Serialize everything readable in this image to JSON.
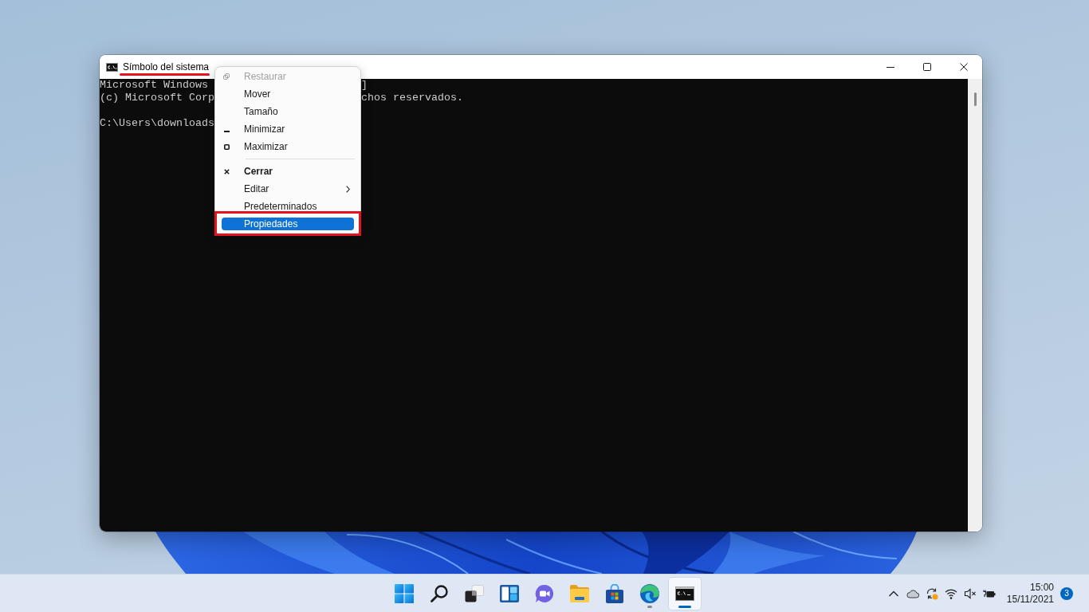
{
  "window": {
    "title": "Símbolo del sistema",
    "title_underlined": true,
    "terminal": {
      "banner": [
        {
          "start": "Microsoft Windows",
          "end": "]"
        },
        {
          "start": "(c) Microsoft Corp",
          "end": "chos reservados."
        }
      ],
      "prompt": "C:\\Users\\downloads"
    }
  },
  "context_menu": {
    "groups": [
      [
        {
          "label": "Restaurar",
          "kind": "restore",
          "disabled": true,
          "default": false,
          "selected": false,
          "highlighted": false
        },
        {
          "label": "Mover",
          "kind": "plain",
          "disabled": false,
          "default": false,
          "selected": false,
          "highlighted": false
        },
        {
          "label": "Tamaño",
          "kind": "plain",
          "disabled": false,
          "default": false,
          "selected": false,
          "highlighted": false
        },
        {
          "label": "Minimizar",
          "kind": "minimize",
          "disabled": false,
          "default": false,
          "selected": false,
          "highlighted": false
        },
        {
          "label": "Maximizar",
          "kind": "maximize",
          "disabled": false,
          "default": false,
          "selected": false,
          "highlighted": false
        }
      ],
      [
        {
          "label": "Cerrar",
          "kind": "close",
          "disabled": false,
          "default": true,
          "selected": false,
          "highlighted": false
        },
        {
          "label": "Editar",
          "kind": "submenu",
          "disabled": false,
          "default": false,
          "selected": false,
          "highlighted": false
        },
        {
          "label": "Predeterminados",
          "kind": "plain",
          "disabled": false,
          "default": false,
          "selected": false,
          "highlighted": false
        },
        {
          "label": "Propiedades",
          "kind": "plain",
          "disabled": false,
          "default": false,
          "selected": true,
          "highlighted": true
        }
      ]
    ]
  },
  "taskbar": {
    "apps": [
      {
        "kind": "start",
        "running": false,
        "active": false
      },
      {
        "kind": "search",
        "running": false,
        "active": false
      },
      {
        "kind": "task_view",
        "running": false,
        "active": false
      },
      {
        "kind": "widgets",
        "running": false,
        "active": false
      },
      {
        "kind": "chat",
        "running": false,
        "active": false
      },
      {
        "kind": "folder",
        "running": false,
        "active": false
      },
      {
        "kind": "store",
        "running": false,
        "active": false
      },
      {
        "kind": "browser",
        "running": true,
        "active": false
      },
      {
        "kind": "terminal",
        "running": true,
        "active": true
      }
    ],
    "tray": {
      "time": "15:00",
      "date": "15/11/2021",
      "notifications": "3"
    }
  }
}
